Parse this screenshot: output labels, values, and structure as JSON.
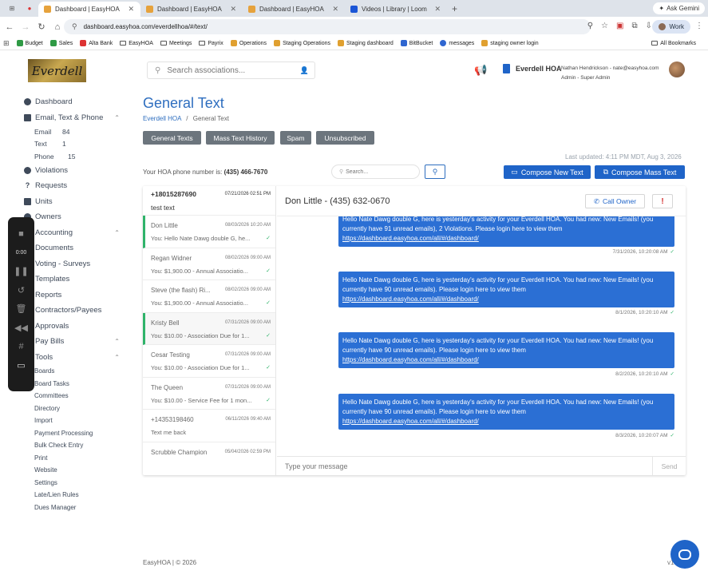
{
  "browser": {
    "tabs": [
      {
        "title": "Dashboard | EasyHOA",
        "active": true
      },
      {
        "title": "Dashboard | EasyHOA",
        "active": false
      },
      {
        "title": "Dashboard | EasyHOA",
        "active": false
      },
      {
        "title": "Videos | Library | Loom",
        "active": false
      }
    ],
    "new_tab": "+",
    "gemini": "Ask Gemini",
    "url": "dashboard.easyhoa.com/everdellhoa/#/text/",
    "profile": "Work",
    "bookmarks": [
      "Budget",
      "Sales",
      "Alta Bank",
      "EasyHOA",
      "Meetings",
      "Payrix",
      "Operations",
      "Staging Operations",
      "Staging dashboard",
      "BitBucket",
      "messages",
      "staging owner login"
    ],
    "all_bookmarks": "All Bookmarks"
  },
  "header": {
    "logo_text": "Everdell",
    "search_placeholder": "Search associations...",
    "hoa_name": "Everdell HOA",
    "user_line": "Nathan Hendrickson - nate@easyhoa.com",
    "role_line": "Admin - Super Admin"
  },
  "sidebar": {
    "items": [
      {
        "label": "Dashboard"
      },
      {
        "label": "Email, Text & Phone",
        "chevron": "⌃"
      },
      {
        "label": "Violations"
      },
      {
        "label": "Requests"
      },
      {
        "label": "Units"
      },
      {
        "label": "Owners"
      },
      {
        "label": "Accounting",
        "chevron": "⌃"
      },
      {
        "label": "Documents"
      },
      {
        "label": "Voting - Surveys"
      },
      {
        "label": "Templates"
      },
      {
        "label": "Reports"
      },
      {
        "label": "Contractors/Payees"
      },
      {
        "label": "Approvals"
      },
      {
        "label": "Pay Bills",
        "chevron": "⌃"
      },
      {
        "label": "Tools",
        "chevron": "⌃"
      }
    ],
    "comm_sub": [
      {
        "label": "Email",
        "count": "84"
      },
      {
        "label": "Text",
        "count": "1"
      },
      {
        "label": "Phone",
        "count": "15"
      }
    ],
    "tools": [
      "Boards",
      "Board Tasks",
      "Committees",
      "Directory",
      "Import",
      "Payment Processing",
      "Bulk Check Entry",
      "Print",
      "Website",
      "Settings",
      "Late/Lien Rules",
      "Dues Manager"
    ]
  },
  "recorder": {
    "time": "0:00"
  },
  "page": {
    "title": "General Text",
    "breadcrumb_root": "Everdell HOA",
    "breadcrumb_sep": "/",
    "breadcrumb_current": "General Text",
    "tabs": [
      "General Texts",
      "Mass Text History",
      "Spam",
      "Unsubscribed"
    ],
    "last_updated": "Last updated: 4:11 PM MDT, Aug 3, 2026",
    "phone_label": "Your HOA phone number is:",
    "phone_number": "(435) 466-7670",
    "conv_search_placeholder": "Search...",
    "compose_new": "Compose New Text",
    "compose_mass": "Compose Mass Text"
  },
  "conversations": [
    {
      "name": "+18015287690",
      "date": "07/21/2026 02:51 PM",
      "preview": "test text",
      "check": false
    },
    {
      "name": "Don Little",
      "date": "08/03/2026 10:20 AM",
      "preview": "You: Hello Nate Dawg double G, he...",
      "check": true
    },
    {
      "name": "Regan Widner",
      "date": "08/02/2026 09:00 AM",
      "preview": "You: $1,900.00 - Annual Associatio...",
      "check": true
    },
    {
      "name": "Steve (the flash) Ri...",
      "date": "08/02/2026 09:00 AM",
      "preview": "You: $1,900.00 - Annual Associatio...",
      "check": true
    },
    {
      "name": "Kristy Bell",
      "date": "07/31/2026 09:00 AM",
      "preview": "You: $10.00 - Association Due for 1...",
      "check": true
    },
    {
      "name": "Cesar Testing",
      "date": "07/31/2026 09:00 AM",
      "preview": "You: $10.00 - Association Due for 1...",
      "check": true
    },
    {
      "name": "The Queen",
      "date": "07/31/2026 09:00 AM",
      "preview": "You: $10.00 - Service Fee for 1 mon...",
      "check": true
    },
    {
      "name": "+14353198460",
      "date": "06/11/2026 09:40 AM",
      "preview": "Text me back",
      "check": false
    },
    {
      "name": "Scrubble Champion",
      "date": "05/04/2026 02:59 PM",
      "preview": "",
      "check": false
    }
  ],
  "thread": {
    "contact": "Don Little - (435) 632-0670",
    "call_owner": "Call Owner",
    "alert": "!",
    "messages": [
      {
        "text": "Hello Nate Dawg double G, here is yesterday's activity for your Everdell HOA. You had new: New Emails! (you currently have 91 unread emails), 2 Violations. Please login here to view them",
        "link": "https://dashboard.easyhoa.com/all/#/dashboard/",
        "time": "7/31/2026, 10:20:08 AM"
      },
      {
        "text": "Hello Nate Dawg double G, here is yesterday's activity for your Everdell HOA. You had new: New Emails! (you currently have 90 unread emails). Please login here to view them",
        "link": "https://dashboard.easyhoa.com/all/#/dashboard/",
        "time": "8/1/2026, 10:20:10 AM"
      },
      {
        "text": "Hello Nate Dawg double G, here is yesterday's activity for your Everdell HOA. You had new: New Emails! (you currently have 90 unread emails). Please login here to view them",
        "link": "https://dashboard.easyhoa.com/all/#/dashboard/",
        "time": "8/2/2026, 10:20:10 AM"
      },
      {
        "text": "Hello Nate Dawg double G, here is yesterday's activity for your Everdell HOA. You had new: New Emails! (you currently have 90 unread emails). Please login here to view them",
        "link": "https://dashboard.easyhoa.com/all/#/dashboard/",
        "time": "8/3/2026, 10:20:07 AM"
      }
    ],
    "composer_placeholder": "Type your message",
    "send": "Send"
  },
  "footer": {
    "text": "EasyHOA | © 2026",
    "version": "v1"
  },
  "colors": {
    "accent": "#1f64c8",
    "title": "#2e6ebf",
    "success": "#2fb36a",
    "tab_button": "#6c757d"
  }
}
